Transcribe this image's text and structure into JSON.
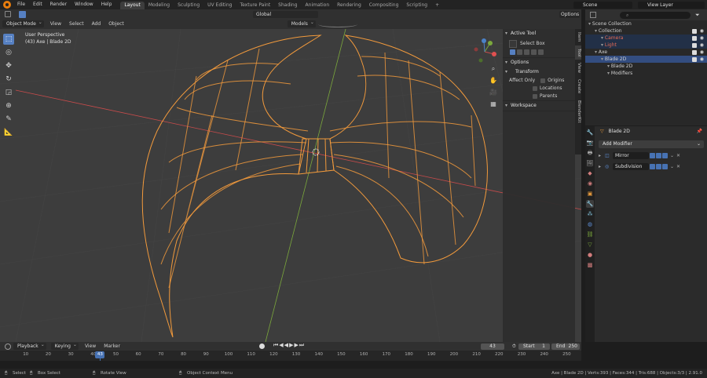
{
  "menu": [
    "File",
    "Edit",
    "Render",
    "Window",
    "Help"
  ],
  "workspaces": [
    "Layout",
    "Modeling",
    "Sculpting",
    "UV Editing",
    "Texture Paint",
    "Shading",
    "Animation",
    "Rendering",
    "Compositing",
    "Scripting"
  ],
  "active_workspace": "Layout",
  "scene": "Scene",
  "view_layer": "View Layer",
  "viewport_header": {
    "mode": "Object Mode",
    "menus": [
      "View",
      "Select",
      "Add",
      "Object"
    ],
    "orientation": "Global",
    "transform_pivot": "Models",
    "options": "Options"
  },
  "viewport_info": {
    "line1": "User Perspective",
    "line2": "(43) Axe | Blade 2D"
  },
  "tools": [
    "select-box",
    "cursor",
    "move",
    "rotate",
    "scale",
    "transform",
    "annotate",
    "measure"
  ],
  "n_panel": {
    "active_tool_title": "Active Tool",
    "active_tool": "Select Box",
    "options_title": "Options",
    "transform_title": "Transform",
    "affect_only": "Affect Only",
    "affect_items": [
      "Origins",
      "Locations",
      "Parents"
    ],
    "workspace_title": "Workspace",
    "tabs": [
      "Item",
      "Tool",
      "View",
      "Create",
      "BlenderKit"
    ]
  },
  "outliner": {
    "rows": [
      {
        "label": "Scene Collection",
        "indent": 0,
        "state": "normal"
      },
      {
        "label": "Collection",
        "indent": 1,
        "state": "normal"
      },
      {
        "label": "Camera",
        "indent": 2,
        "state": "hl",
        "color": "#e66b56"
      },
      {
        "label": "Light",
        "indent": 2,
        "state": "hl",
        "color": "#e66b56"
      },
      {
        "label": "Axe",
        "indent": 1,
        "state": "normal"
      },
      {
        "label": "Blade 2D",
        "indent": 2,
        "state": "sel"
      },
      {
        "label": "Blade 2D",
        "indent": 3,
        "state": "normal"
      },
      {
        "label": "Modifiers",
        "indent": 3,
        "state": "normal"
      }
    ]
  },
  "properties": {
    "object_name": "Blade 2D",
    "add_modifier": "Add Modifier",
    "modifiers": [
      "Mirror",
      "Subdivision"
    ]
  },
  "timeline": {
    "menus": [
      "Playback",
      "Keying",
      "View",
      "Marker"
    ],
    "current_frame": "43",
    "start_label": "Start",
    "start": "1",
    "end_label": "End",
    "end": "250",
    "ticks": [
      "10",
      "20",
      "30",
      "40",
      "50",
      "60",
      "70",
      "80",
      "90",
      "100",
      "110",
      "120",
      "130",
      "140",
      "150",
      "160",
      "170",
      "180",
      "190",
      "200",
      "210",
      "220",
      "230",
      "240",
      "250"
    ],
    "playhead": "43"
  },
  "statusbar": {
    "select": "Select",
    "box_select": "Box Select",
    "rotate": "Rotate View",
    "context": "Object Context Menu",
    "stats": "Axe | Blade 2D | Verts:393 | Faces:344 | Tris:688 | Objects:3/3 | 2.91.0"
  },
  "colors": {
    "accent": "#5680c2",
    "wire": "#f29a3c",
    "x_axis": "#c84b4b",
    "y_axis": "#7ba83c"
  }
}
